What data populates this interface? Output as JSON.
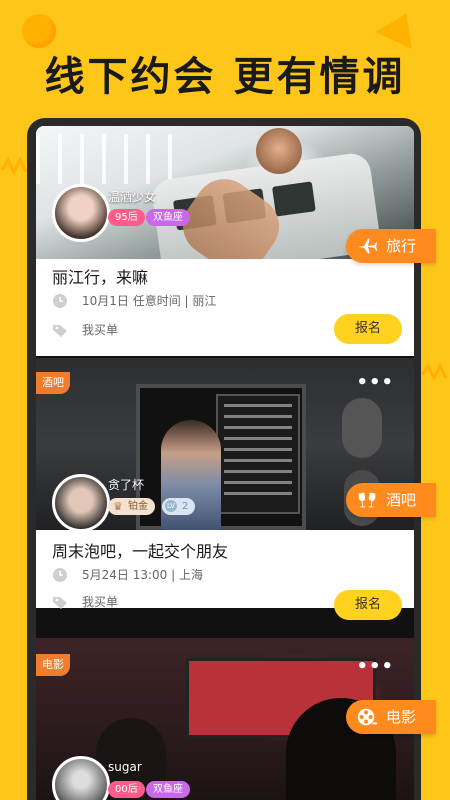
{
  "headline": "线下约会  更有情调",
  "colors": {
    "background": "#FFC61A",
    "accent": "#FF8A1E",
    "button": "#FFD21F"
  },
  "cards": [
    {
      "user": "温酒少女",
      "tags": [
        "95后",
        "双鱼座"
      ],
      "title": "丽江行，来嘛",
      "meta": "10月1日  任意时间 | 丽江",
      "payer": "我买单",
      "button": "报名",
      "category": "旅行",
      "category_icon": "airplane-icon"
    },
    {
      "corner": "酒吧",
      "user": "贪了杯",
      "tags": [
        "铂金",
        "2"
      ],
      "title": "周末泡吧，一起交个朋友",
      "meta": "5月24日 13:00 | 上海",
      "payer": "我买单",
      "button": "报名",
      "category": "酒吧",
      "category_icon": "cheers-icon"
    },
    {
      "corner": "电影",
      "user": "sugar",
      "tags": [
        "00后",
        "双鱼座"
      ],
      "category": "电影",
      "category_icon": "film-reel-icon"
    }
  ]
}
